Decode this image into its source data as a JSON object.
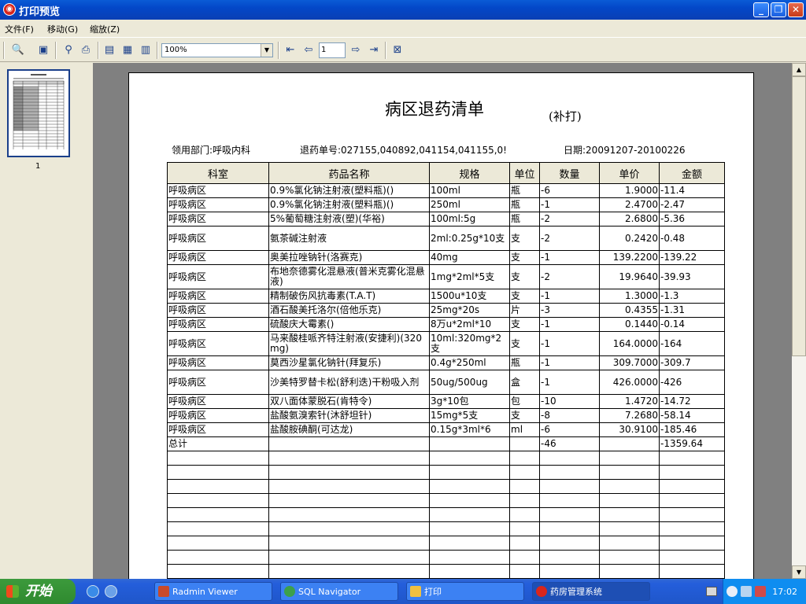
{
  "window": {
    "title": "打印预览",
    "app_icon": "print-preview-app-icon"
  },
  "menu": [
    "文件(F)",
    "移动(G)",
    "缩放(Z)"
  ],
  "toolbar": {
    "zoom_value": "100%",
    "page_value": "1"
  },
  "thumbnail": {
    "page_label": "1"
  },
  "report": {
    "title": "病区退药清单",
    "subtitle": "(补打)",
    "department": "领用部门:呼吸内科",
    "order_no": "退药单号:027155,040892,041154,041155,0!",
    "date": "日期:20091207-20100226",
    "headers": [
      "科室",
      "药品名称",
      "规格",
      "单位",
      "数量",
      "单价",
      "金额"
    ],
    "rows": [
      {
        "dept": "呼吸病区",
        "name": "0.9%氯化钠注射液(塑料瓶)()",
        "spec": "100ml",
        "unit": "瓶",
        "qty": "-6",
        "price": "1.9000",
        "amount": "-11.4"
      },
      {
        "dept": "呼吸病区",
        "name": "0.9%氯化钠注射液(塑料瓶)()",
        "spec": "250ml",
        "unit": "瓶",
        "qty": "-1",
        "price": "2.4700",
        "amount": "-2.47"
      },
      {
        "dept": "呼吸病区",
        "name": "5%葡萄糖注射液(塑)(华裕)",
        "spec": "100ml:5g",
        "unit": "瓶",
        "qty": "-2",
        "price": "2.6800",
        "amount": "-5.36"
      },
      {
        "dept": "呼吸病区",
        "name": "氨茶碱注射液",
        "spec": "2ml:0.25g*10支",
        "unit": "支",
        "qty": "-2",
        "price": "0.2420",
        "amount": "-0.48"
      },
      {
        "dept": "呼吸病区",
        "name": "奥美拉唑钠针(洛赛克)",
        "spec": "40mg",
        "unit": "支",
        "qty": "-1",
        "price": "139.2200",
        "amount": "-139.22"
      },
      {
        "dept": "呼吸病区",
        "name": "布地奈德雾化混悬液(普米克雾化混悬液)",
        "spec": "1mg*2ml*5支",
        "unit": "支",
        "qty": "-2",
        "price": "19.9640",
        "amount": "-39.93"
      },
      {
        "dept": "呼吸病区",
        "name": "精制破伤风抗毒素(T.A.T)",
        "spec": "1500u*10支",
        "unit": "支",
        "qty": "-1",
        "price": "1.3000",
        "amount": "-1.3"
      },
      {
        "dept": "呼吸病区",
        "name": "酒石酸美托洛尔(倍他乐克)",
        "spec": "25mg*20s",
        "unit": "片",
        "qty": "-3",
        "price": "0.4355",
        "amount": "-1.31"
      },
      {
        "dept": "呼吸病区",
        "name": "硫酸庆大霉素()",
        "spec": "8万u*2ml*10",
        "unit": "支",
        "qty": "-1",
        "price": "0.1440",
        "amount": "-0.14"
      },
      {
        "dept": "呼吸病区",
        "name": "马来酸桂哌齐特注射液(安捷利)(320mg)",
        "spec": "10ml:320mg*2支",
        "unit": "支",
        "qty": "-1",
        "price": "164.0000",
        "amount": "-164"
      },
      {
        "dept": "呼吸病区",
        "name": "莫西沙星氯化钠针(拜复乐)",
        "spec": "0.4g*250ml",
        "unit": "瓶",
        "qty": "-1",
        "price": "309.7000",
        "amount": "-309.7"
      },
      {
        "dept": "呼吸病区",
        "name": "沙美特罗替卡松(舒利迭)干粉吸入剂",
        "spec": "50ug/500ug",
        "unit": "盒",
        "qty": "-1",
        "price": "426.0000",
        "amount": "-426"
      },
      {
        "dept": "呼吸病区",
        "name": "双八面体蒙脱石(肯特令)",
        "spec": "3g*10包",
        "unit": "包",
        "qty": "-10",
        "price": "1.4720",
        "amount": "-14.72"
      },
      {
        "dept": "呼吸病区",
        "name": "盐酸氨溴索针(沐舒坦针)",
        "spec": "15mg*5支",
        "unit": "支",
        "qty": "-8",
        "price": "7.2680",
        "amount": "-58.14"
      },
      {
        "dept": "呼吸病区",
        "name": "盐酸胺碘酮(可达龙)",
        "spec": "0.15g*3ml*6",
        "unit": "ml",
        "qty": "-6",
        "price": "30.9100",
        "amount": "-185.46"
      }
    ],
    "total": {
      "label": "总计",
      "qty": "-46",
      "amount": "-1359.64"
    }
  },
  "taskbar": {
    "start_label": "开始",
    "tasks": [
      "Radmin Viewer",
      "SQL Navigator",
      "打印",
      "药房管理系统"
    ],
    "clock": "17:02"
  }
}
